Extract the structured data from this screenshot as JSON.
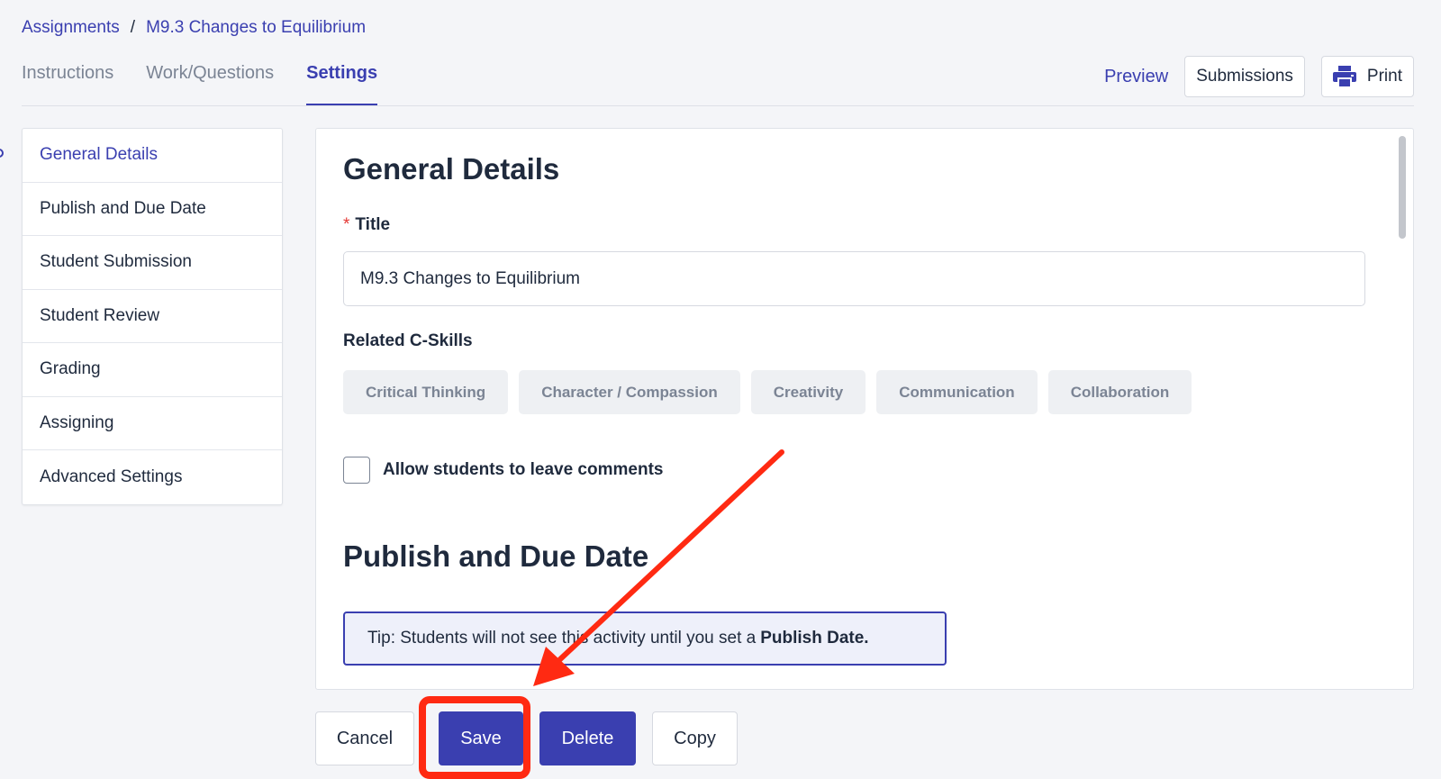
{
  "breadcrumb": {
    "root": "Assignments",
    "separator": "/",
    "current": "M9.3 Changes to Equilibrium"
  },
  "tabs": [
    {
      "label": "Instructions"
    },
    {
      "label": "Work/Questions"
    },
    {
      "label": "Settings",
      "active": true
    }
  ],
  "top_actions": {
    "preview": "Preview",
    "submissions": "Submissions",
    "print": "Print",
    "print_icon": "printer-icon"
  },
  "side_nav": {
    "items": [
      {
        "label": "General Details",
        "active": true
      },
      {
        "label": "Publish and Due Date"
      },
      {
        "label": "Student Submission"
      },
      {
        "label": "Student Review"
      },
      {
        "label": "Grading"
      },
      {
        "label": "Assigning"
      },
      {
        "label": "Advanced Settings"
      }
    ]
  },
  "panel": {
    "general_heading": "General Details",
    "title_required_mark": "*",
    "title_label": "Title",
    "title_value": "M9.3 Changes to Equilibrium",
    "cskills_label": "Related C-Skills",
    "cskills": [
      "Critical Thinking",
      "Character / Compassion",
      "Creativity",
      "Communication",
      "Collaboration"
    ],
    "allow_comments_label": "Allow students to leave comments",
    "allow_comments_checked": false,
    "publish_heading": "Publish and Due Date",
    "tip_text": "Tip: Students will not see this activity until you set a",
    "tip_bold": "Publish Date."
  },
  "bottom_actions": {
    "cancel": "Cancel",
    "save": "Save",
    "delete": "Delete",
    "copy": "Copy"
  },
  "colors": {
    "accent": "#3a3fb0",
    "annotation": "#ff2a12"
  }
}
